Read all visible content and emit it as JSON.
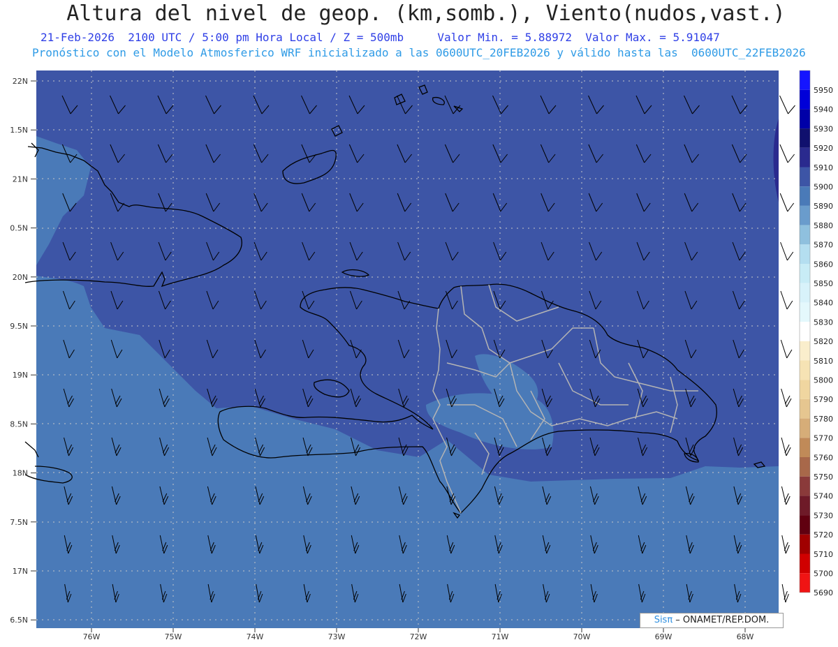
{
  "header": {
    "title": "Altura del nivel de geop. (km,somb.), Viento(nudos,vast.)",
    "line1": "21-Feb-2026  2100 UTC / 5:00 pm Hora Local / Z = 500mb     Valor Min. = 5.88972  Valor Max. = 5.91047",
    "line2": "Pronóstico con el Modelo Atmosferico WRF inicializado a las 0600UTC_20FEB2026 y válido hasta las  0600UTC_22FEB2026"
  },
  "axes": {
    "lat_labels": [
      "22N",
      "1.5N",
      "21N",
      "0.5N",
      "20N",
      "9.5N",
      "19N",
      "8.5N",
      "18N",
      "7.5N",
      "17N",
      "6.5N"
    ],
    "lon_labels": [
      "76W",
      "75W",
      "74W",
      "73W",
      "72W",
      "71W",
      "70W",
      "69W",
      "68W"
    ]
  },
  "colorbar": {
    "levels": [
      "5950",
      "5940",
      "5930",
      "5920",
      "5910",
      "5900",
      "5890",
      "5880",
      "5870",
      "5860",
      "5850",
      "5840",
      "5830",
      "5820",
      "5810",
      "5800",
      "5790",
      "5780",
      "5770",
      "5760",
      "5750",
      "5740",
      "5730",
      "5720",
      "5710",
      "5700",
      "5690"
    ],
    "colors": [
      "#1515ff",
      "#0000d8",
      "#0000a8",
      "#10106e",
      "#2a2a8e",
      "#3d55a6",
      "#4a7ab8",
      "#6a9ccc",
      "#8fc0de",
      "#b4def0",
      "#c8ecf6",
      "#d8f2fa",
      "#e4f8fc",
      "#ffffff",
      "#faeecc",
      "#f6e3b4",
      "#f0d6a0",
      "#e6c690",
      "#d6ad78",
      "#c08a58",
      "#a8684a",
      "#8a3a3a",
      "#6e1a28",
      "#600010",
      "#a00000",
      "#d00000",
      "#f01414"
    ]
  },
  "credit": {
    "logo": "Sisπ",
    "text": " – ONAMET/REP.DOM."
  },
  "colors": {
    "fill_5900": "#3d55a6",
    "fill_5890": "#4a7ab8",
    "fill_5880": "#6a9ccc",
    "coast": "#000000",
    "provinces": "#b4b4b4"
  }
}
